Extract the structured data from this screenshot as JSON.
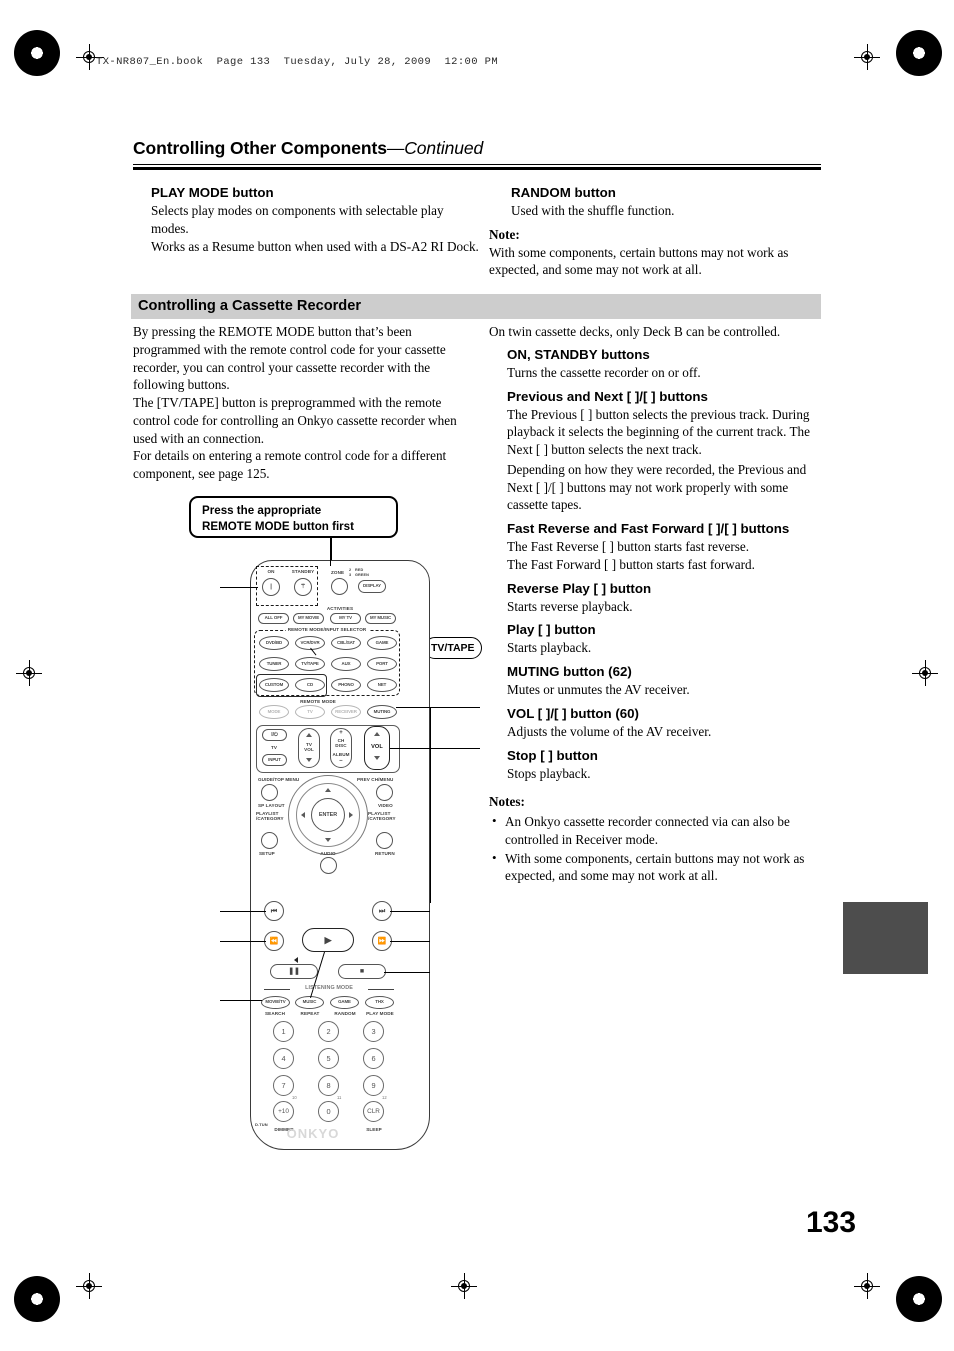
{
  "book_header": "TX-NR807_En.book  Page 133  Tuesday, July 28, 2009  12:00 PM",
  "chapter": {
    "title": "Controlling Other Components",
    "continued": "—Continued"
  },
  "page_number": "133",
  "left_column_top": {
    "heading": "PLAY MODE button",
    "paragraphs": [
      "Selects play modes on components with selectable play modes.",
      "Works as a Resume button when used with a DS-A2 RI Dock."
    ]
  },
  "right_column_top": {
    "heading": "RANDOM button",
    "paragraph": "Used with the shuffle function.",
    "note_label": "Note:",
    "note_text": "With some components, certain buttons may not work as expected, and some may not work at all."
  },
  "section": {
    "band_title": "Controlling a Cassette Recorder",
    "left_paragraphs": [
      "By pressing the REMOTE MODE button that’s been programmed with the remote control code for your cassette recorder, you can control your cassette recorder with the following buttons.",
      "The [TV/TAPE] button is preprogrammed with the remote control code for controlling an Onkyo cassette recorder when used with an          connection.",
      "For details on entering a remote control code for a different component, see page 125."
    ],
    "right_intro": "On twin cassette decks, only Deck B can be controlled."
  },
  "callout": {
    "line1": "Press the appropriate",
    "line2": "REMOTE MODE button first"
  },
  "tvtape_callout": "TV/TAPE",
  "button_entries": [
    {
      "heading": "ON, STANDBY buttons",
      "body": "Turns the cassette recorder on or off."
    },
    {
      "heading": "Previous and Next [      ]/[      ] buttons",
      "body": "The Previous [      ] button selects the previous track. During playback it selects the beginning of the current track. The Next [      ] button selects the next track.",
      "body2": "Depending on how they were recorded, the Previous and Next [      ]/[      ] buttons may not work properly with some cassette tapes."
    },
    {
      "heading": "Fast Reverse and Fast Forward [      ]/[      ] buttons",
      "body": "The Fast Reverse [      ] button starts fast reverse.",
      "body2": "The Fast Forward [      ] button starts fast forward."
    },
    {
      "heading": "Reverse Play [      ] button",
      "body": "Starts reverse playback."
    },
    {
      "heading": "Play [      ] button",
      "body": "Starts playback."
    },
    {
      "heading": "MUTING button (62)",
      "body": "Mutes or unmutes the AV receiver."
    },
    {
      "heading": "VOL [   ]/[   ] button (60)",
      "body": "Adjusts the volume of the AV receiver."
    },
    {
      "heading": "Stop [   ] button",
      "body": "Stops playback."
    }
  ],
  "bottom_notes": {
    "label": "Notes:",
    "items": [
      "An Onkyo cassette recorder connected via        can also be controlled in Receiver mode.",
      "With some components, certain buttons may not work as expected, and some may not work at all."
    ]
  },
  "remote": {
    "power": {
      "on": "ON",
      "standby": "STANDBY"
    },
    "zone": {
      "label": "ZONE",
      "n2": "2",
      "n3": "3",
      "red": "RED",
      "green": "GREEN",
      "display": "DISPLAY"
    },
    "activities_label": "ACTIVITIES",
    "activities": [
      "ALL OFF",
      "MY MOVIE",
      "MY TV",
      "MY MUSIC"
    ],
    "selector_label": "REMOTE MODE/INPUT SELECTOR",
    "selector_rows": [
      [
        "DVD/BD",
        "VCR/DVR",
        "CBL/SAT",
        "GAME"
      ],
      [
        "TUNER",
        "TV/TAPE",
        "AUX",
        "PORT"
      ],
      [
        "CUSTOM",
        "CD",
        "PHONO",
        "NET"
      ]
    ],
    "remote_mode_label": "REMOTE MODE",
    "mode_row": [
      "MODE",
      "TV",
      "RECEIVER",
      "MUTING"
    ],
    "tv_power": "I/⏻",
    "tv_label": "TV",
    "input_label": "INPUT",
    "tv_vol_label": "TV VOL",
    "ch_disc": "CH DISC",
    "album": "ALBUM",
    "vol_label": "VOL",
    "guide_top_menu": "GUIDE/TOP MENU",
    "prev_ch_menu": "PREV CH/MENU",
    "sp_layout": "SP LAYOUT",
    "video_label": "VIDEO",
    "playlist_left": "PLAYLIST /CATEGORY",
    "playlist_right": "PLAYLIST /CATEGORY",
    "enter": "ENTER",
    "setup": "SETUP",
    "return": "RETURN",
    "audio": "AUDIO",
    "listening_mode_label": "LISTENING MODE",
    "listening_buttons": [
      "MOVIE/TV",
      "MUSIC",
      "GAME",
      "THX"
    ],
    "listening_sublabels": [
      "SEARCH",
      "REPEAT",
      "RANDOM",
      "PLAY MODE"
    ],
    "numpad": [
      "1",
      "2",
      "3",
      "4",
      "5",
      "6",
      "7",
      "8",
      "9",
      "+10",
      "0",
      "CLR"
    ],
    "numpad_sup": [
      "10",
      "11",
      "12"
    ],
    "dtun": "D.TUN",
    "dimmer": "DIMMER",
    "sleep": "SLEEP",
    "brand": "ONKYO"
  }
}
